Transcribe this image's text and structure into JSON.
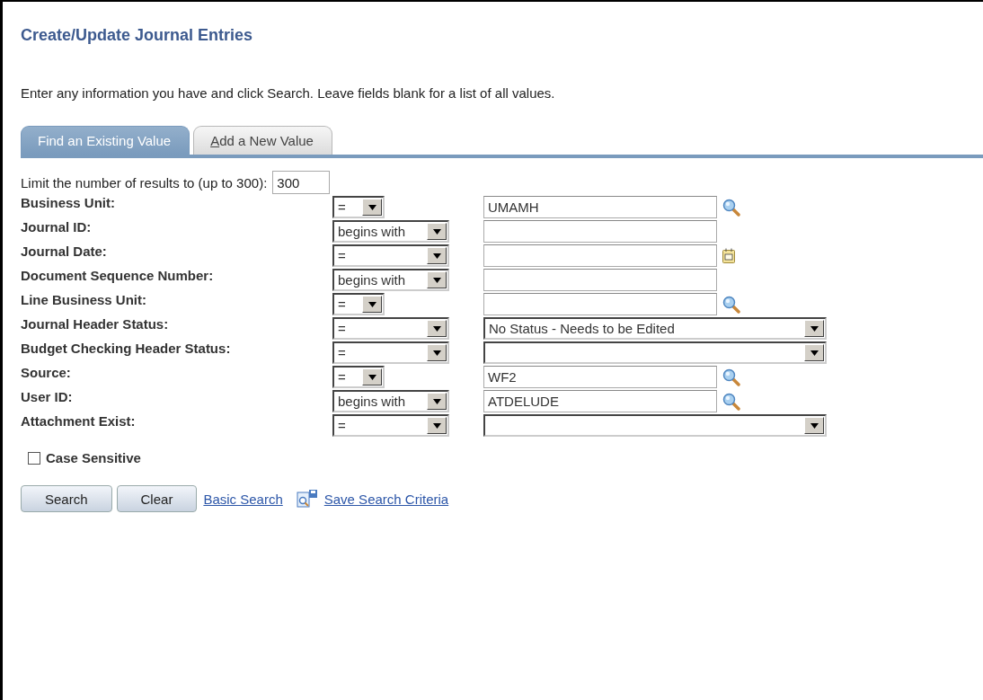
{
  "page": {
    "title": "Create/Update Journal Entries",
    "instructions": "Enter any information you have and click Search. Leave fields blank for a list of all values."
  },
  "tabs": [
    {
      "label": "Find an Existing Value",
      "selected": true,
      "accesskey": false
    },
    {
      "label": "Add a New Value",
      "selected": false,
      "accesskey": true
    }
  ],
  "limit": {
    "label": "Limit the number of results to (up to 300):",
    "value": "300"
  },
  "fields": [
    {
      "label": "Business Unit:",
      "operator": {
        "label": "=",
        "kind": "short"
      },
      "kind": "lookup",
      "value": "UMAMH"
    },
    {
      "label": "Journal ID:",
      "operator": {
        "label": "begins with",
        "kind": "long"
      },
      "kind": "text"
    },
    {
      "label": "Journal Date:",
      "operator": {
        "label": "=",
        "kind": "long"
      },
      "kind": "date"
    },
    {
      "label": "Document Sequence Number:",
      "operator": {
        "label": "begins with",
        "kind": "long"
      },
      "kind": "text"
    },
    {
      "label": "Line Business Unit:",
      "operator": {
        "label": "=",
        "kind": "short"
      },
      "kind": "lookup"
    },
    {
      "label": "Journal Header Status:",
      "operator": {
        "label": "=",
        "kind": "long"
      },
      "kind": "select",
      "value": "No Status - Needs to be Edited"
    },
    {
      "label": "Budget Checking Header Status:",
      "operator": {
        "label": "=",
        "kind": "long"
      },
      "kind": "select"
    },
    {
      "label": "Source:",
      "operator": {
        "label": "=",
        "kind": "short"
      },
      "kind": "lookup",
      "value": "WF2"
    },
    {
      "label": "User ID:",
      "operator": {
        "label": "begins with",
        "kind": "long"
      },
      "kind": "lookup",
      "value": "ATDELUDE"
    },
    {
      "label": "Attachment Exist:",
      "operator": {
        "label": "=",
        "kind": "long"
      },
      "kind": "select"
    }
  ],
  "case_sensitive": {
    "label": "Case Sensitive",
    "checked": false
  },
  "actions": [
    {
      "kind": "button",
      "label": "Search"
    },
    {
      "kind": "button",
      "label": "Clear"
    },
    {
      "kind": "link",
      "label": "Basic Search"
    },
    {
      "kind": "icon-link",
      "label": "Save Search Criteria"
    }
  ]
}
